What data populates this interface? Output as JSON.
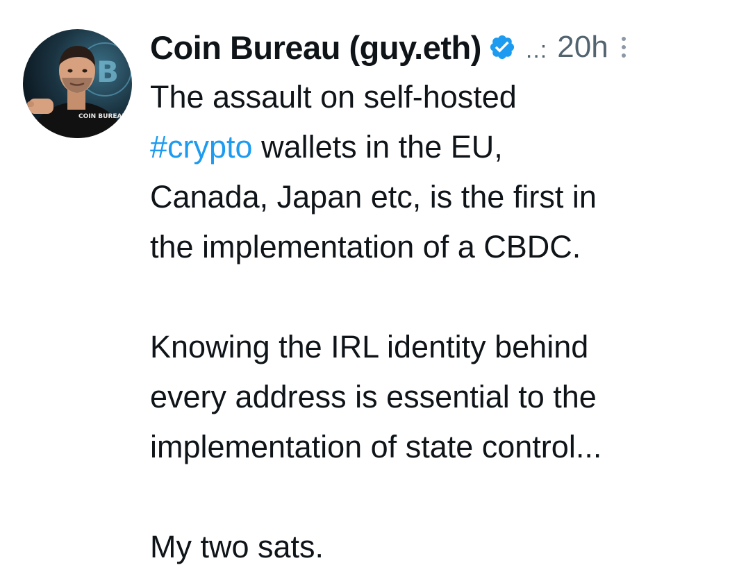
{
  "author": {
    "display_name": "Coin Bureau (guy.eth)",
    "verified": true,
    "separator": "..:",
    "timestamp": "20h"
  },
  "tweet": {
    "paragraph1": {
      "line1": "The assault on self-hosted",
      "hashtag": "#crypto",
      "line2_rest": " wallets in the EU,",
      "line3": "Canada, Japan etc, is the first in",
      "line4": "the implementation of a CBDC."
    },
    "paragraph2": {
      "line1": "Knowing the IRL identity behind",
      "line2": "every address is essential to the",
      "line3": "implementation of state control..."
    },
    "paragraph3": {
      "line1": "My two sats."
    }
  },
  "colors": {
    "text": "#0f1419",
    "secondary": "#536471",
    "link": "#1d9bf0",
    "verified_badge": "#1d9bf0"
  },
  "icons": {
    "verified": "verified-badge-icon",
    "more": "more-vertical-icon",
    "avatar": "profile-avatar"
  }
}
